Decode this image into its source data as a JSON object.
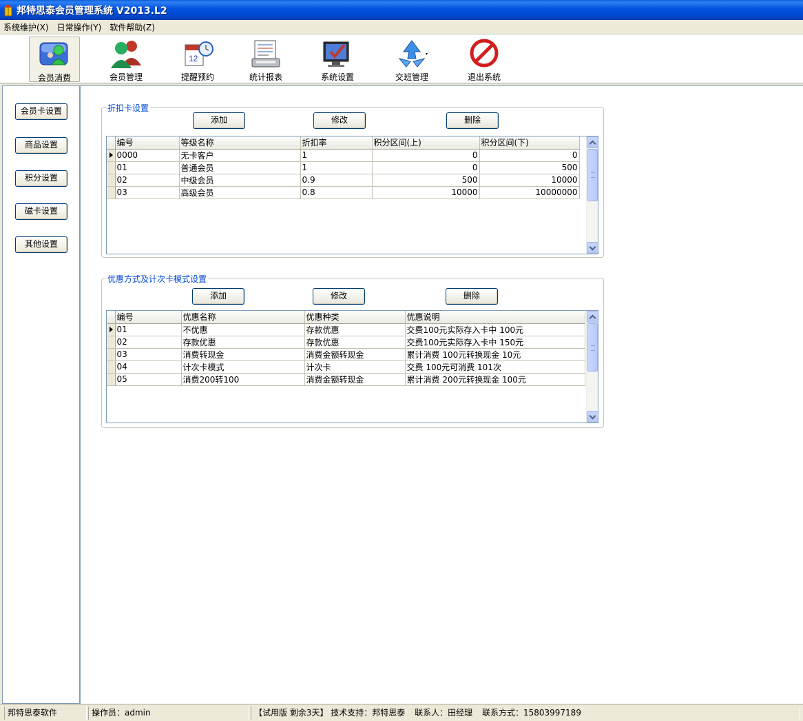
{
  "window": {
    "title": "邦特思泰会员管理系统 V2013.L2"
  },
  "menu": [
    "系统维护(X)",
    "日常操作(Y)",
    "软件帮助(Z)"
  ],
  "toolbar": [
    {
      "label": "会员消费",
      "icon": "member-consume-icon"
    },
    {
      "label": "会员管理",
      "icon": "users-icon"
    },
    {
      "label": "提醒预约",
      "icon": "calendar-clock-icon"
    },
    {
      "label": "统计报表",
      "icon": "report-icon"
    },
    {
      "label": "系统设置",
      "icon": "settings-monitor-icon"
    },
    {
      "label": "交班管理",
      "icon": "shift-recycle-icon"
    },
    {
      "label": "退出系统",
      "icon": "exit-icon"
    }
  ],
  "sidebar": [
    "会员卡设置",
    "商品设置",
    "积分设置",
    "磁卡设置",
    "其他设置"
  ],
  "discount": {
    "legend": "折扣卡设置",
    "buttons": {
      "add": "添加",
      "edit": "修改",
      "delete": "删除"
    },
    "columns": [
      "编号",
      "等级名称",
      "折扣率",
      "积分区间(上)",
      "积分区间(下)"
    ],
    "rows": [
      [
        "0000",
        "无卡客户",
        "1",
        "0",
        "0"
      ],
      [
        "01",
        "普通会员",
        "1",
        "0",
        "500"
      ],
      [
        "02",
        "中级会员",
        "0.9",
        "500",
        "10000"
      ],
      [
        "03",
        "高级会员",
        "0.8",
        "10000",
        "10000000"
      ]
    ]
  },
  "promo": {
    "legend": "优惠方式及计次卡模式设置",
    "buttons": {
      "add": "添加",
      "edit": "修改",
      "delete": "删除"
    },
    "columns": [
      "编号",
      "优惠名称",
      "优惠种类",
      "优惠说明"
    ],
    "rows": [
      [
        "01",
        "不优惠",
        "存款优惠",
        "交费100元实际存入卡中 100元"
      ],
      [
        "02",
        "存款优惠",
        "存款优惠",
        "交费100元实际存入卡中 150元"
      ],
      [
        "03",
        "消费转现金",
        "消费金额转现金",
        "累计消费 100元转换现金 10元"
      ],
      [
        "04",
        "计次卡模式",
        "计次卡",
        "交费 100元可消费 101次"
      ],
      [
        "05",
        "消费200转100",
        "消费金额转现金",
        "累计消费 200元转换现金 100元"
      ]
    ]
  },
  "status": {
    "company": "邦特思泰软件",
    "operator": "操作员：admin",
    "trial": "【试用版  剩余3天】",
    "support": "技术支持：邦特思泰",
    "contact": "联系人：田经理",
    "phone": "联系方式：15803997189"
  }
}
